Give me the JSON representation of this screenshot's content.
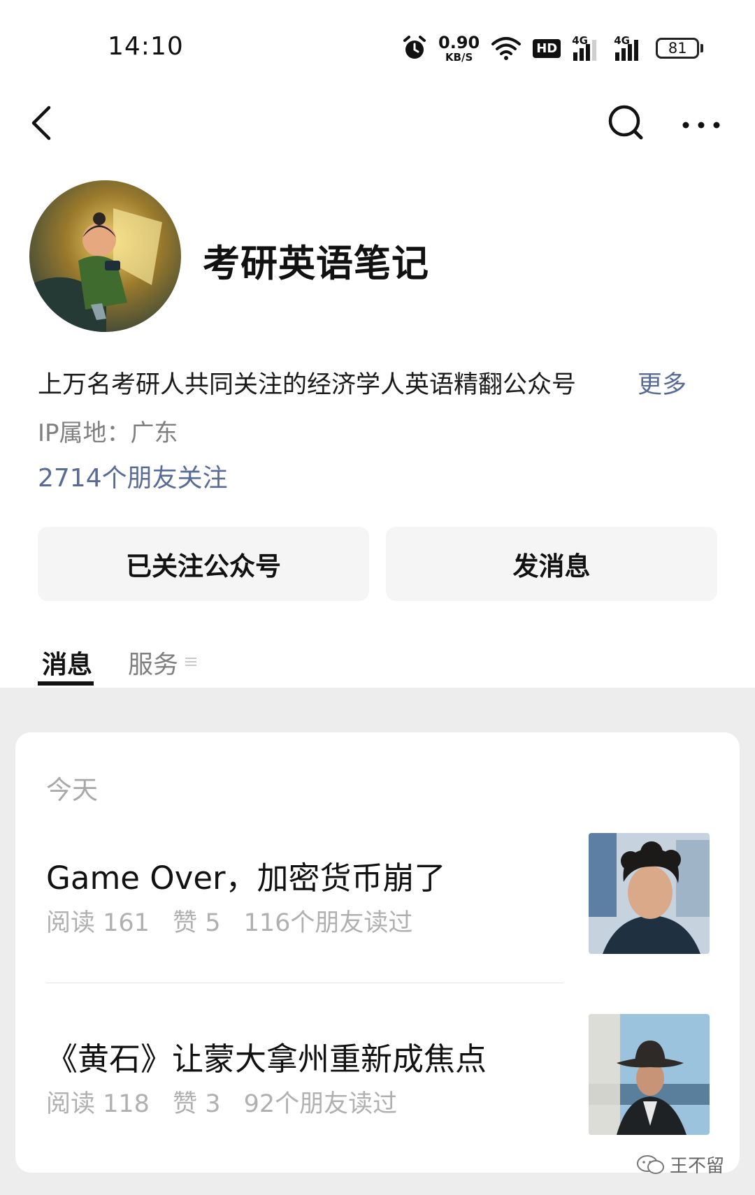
{
  "status_bar": {
    "time": "14:10",
    "net_speed_value": "0.90",
    "net_speed_unit": "KB/S",
    "hd_label": "HD",
    "signal1_label": "4G",
    "signal2_label": "4G",
    "battery": "81"
  },
  "profile": {
    "name": "考研英语笔记",
    "bio": "上万名考研人共同关注的经济学人英语精翻公众号",
    "more_label": "更多",
    "ip_location": "IP属地：广东",
    "followers_text": "2714个朋友关注"
  },
  "actions": {
    "follow_label": "已关注公众号",
    "message_label": "发消息"
  },
  "tabs": {
    "messages_label": "消息",
    "services_label": "服务"
  },
  "feed": {
    "date_label": "今天",
    "articles": [
      {
        "title": "Game Over，加密货币崩了",
        "reads": "阅读 161",
        "likes": "赞 5",
        "friends_read": "116个朋友读过"
      },
      {
        "title": "《黄石》让蒙大拿州重新成焦点",
        "reads": "阅读 118",
        "likes": "赞 3",
        "friends_read": "92个朋友读过"
      }
    ]
  },
  "watermark": {
    "text": "王不留"
  },
  "colors": {
    "link": "#576b95",
    "background": "#ededed",
    "card": "#ffffff",
    "button": "#f5f5f5",
    "muted": "#b0b0b0"
  },
  "icons": [
    "back-arrow-icon",
    "search-icon",
    "more-dots-icon",
    "menu-lines-icon",
    "alarm-icon",
    "wifi-icon",
    "wechat-icon"
  ]
}
